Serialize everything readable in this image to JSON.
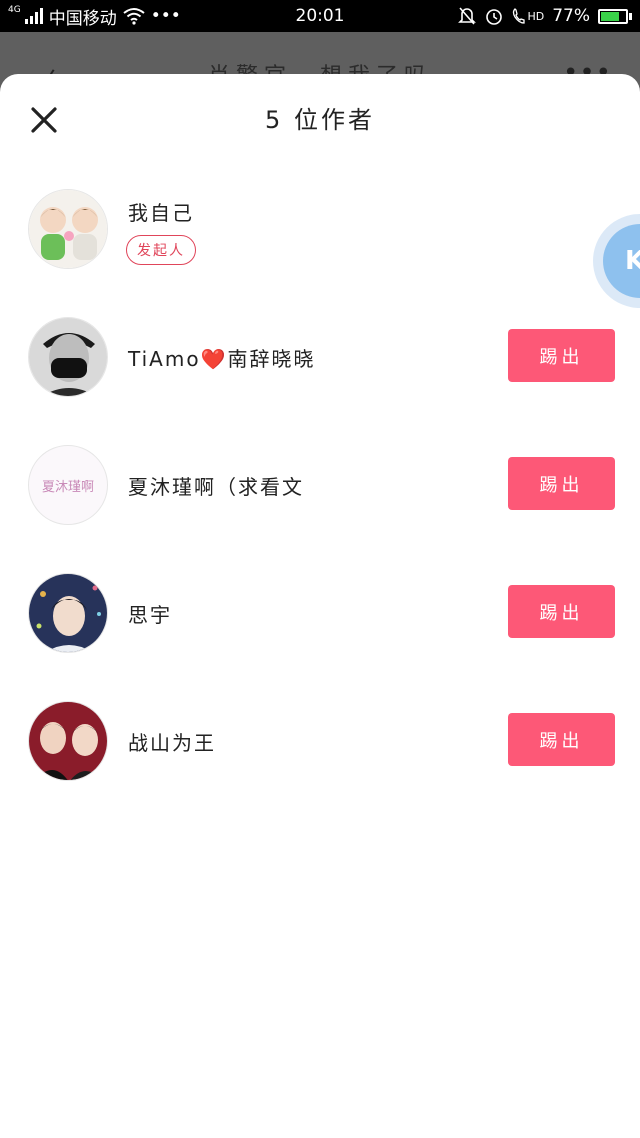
{
  "status_bar": {
    "network_type": "4G",
    "carrier": "中国移动",
    "more": "•••",
    "time": "20:01",
    "hd_label": "HD",
    "battery_text": "77%",
    "battery_level": 0.77
  },
  "background_header": {
    "title": "肖警官　想我了吗"
  },
  "sheet": {
    "title": "5 位作者",
    "authors": [
      {
        "name": "我自己",
        "tag": "发起人",
        "avatar": "avatar-cartoon-pair"
      },
      {
        "name_prefix": "TiAmo",
        "heart": "❤️",
        "name_suffix": "南辞晓晓",
        "button": "踢出",
        "avatar": "avatar-masked-man"
      },
      {
        "name": "夏沐瑾啊（求看文",
        "avatar_text": "夏沐瑾啊",
        "button": "踢出",
        "avatar": "avatar-pink-text"
      },
      {
        "name": "思宇",
        "button": "踢出",
        "avatar": "avatar-portrait"
      },
      {
        "name": "战山为王",
        "button": "踢出",
        "avatar": "avatar-two-people"
      }
    ]
  },
  "floating_bubble": {
    "label": "K"
  },
  "colors": {
    "accent": "#fd5877",
    "tag": "#e0455a",
    "bubble": "#8ec1ee"
  }
}
